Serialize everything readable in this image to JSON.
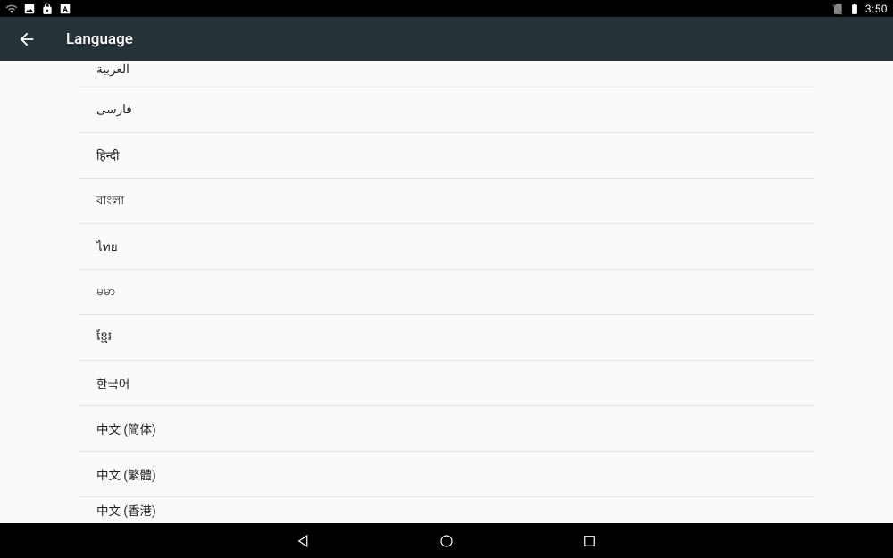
{
  "statusBar": {
    "time": "3:50"
  },
  "appBar": {
    "title": "Language"
  },
  "languages": [
    "العربية",
    "فارسی",
    "हिन्दी",
    "বাংলা",
    "ไทย",
    "မမာ",
    "ខ្មែរ",
    "한국어",
    "中文 (简体)",
    "中文 (繁體)",
    "中文 (香港)"
  ]
}
